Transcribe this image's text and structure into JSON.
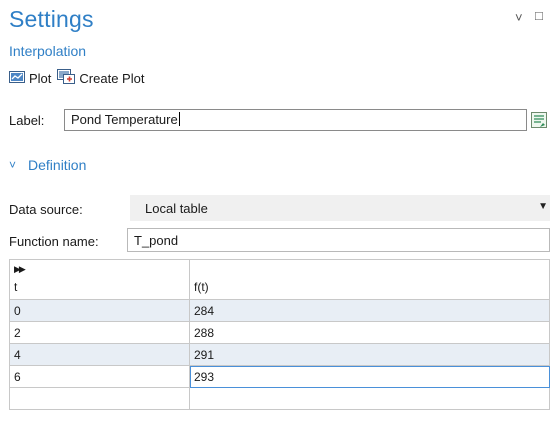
{
  "header": {
    "title": "Settings",
    "subtitle": "Interpolation",
    "collapse_glyph": "˅",
    "maximize_glyph": "□"
  },
  "toolbar": {
    "plot_label": "Plot",
    "create_plot_label": "Create Plot",
    "plot_icon": "plot-icon",
    "create_plot_icon": "create-plot-icon"
  },
  "label_field": {
    "label": "Label:",
    "value": "Pond Temperature",
    "side_icon": "edit-label-icon"
  },
  "definition": {
    "section_title": "Definition",
    "data_source_label": "Data source:",
    "data_source_value": "Local table",
    "function_name_label": "Function name:",
    "function_name_value": "T_pond"
  },
  "table": {
    "columns": [
      "t",
      "f(t)"
    ],
    "rows": [
      [
        "0",
        "284"
      ],
      [
        "2",
        "288"
      ],
      [
        "4",
        "291"
      ],
      [
        "6",
        "293"
      ],
      [
        "",
        ""
      ]
    ]
  },
  "colors": {
    "accent": "#2f7fc6",
    "select_bg": "#f0f0f0",
    "highlight_row": "#e8eef5"
  }
}
